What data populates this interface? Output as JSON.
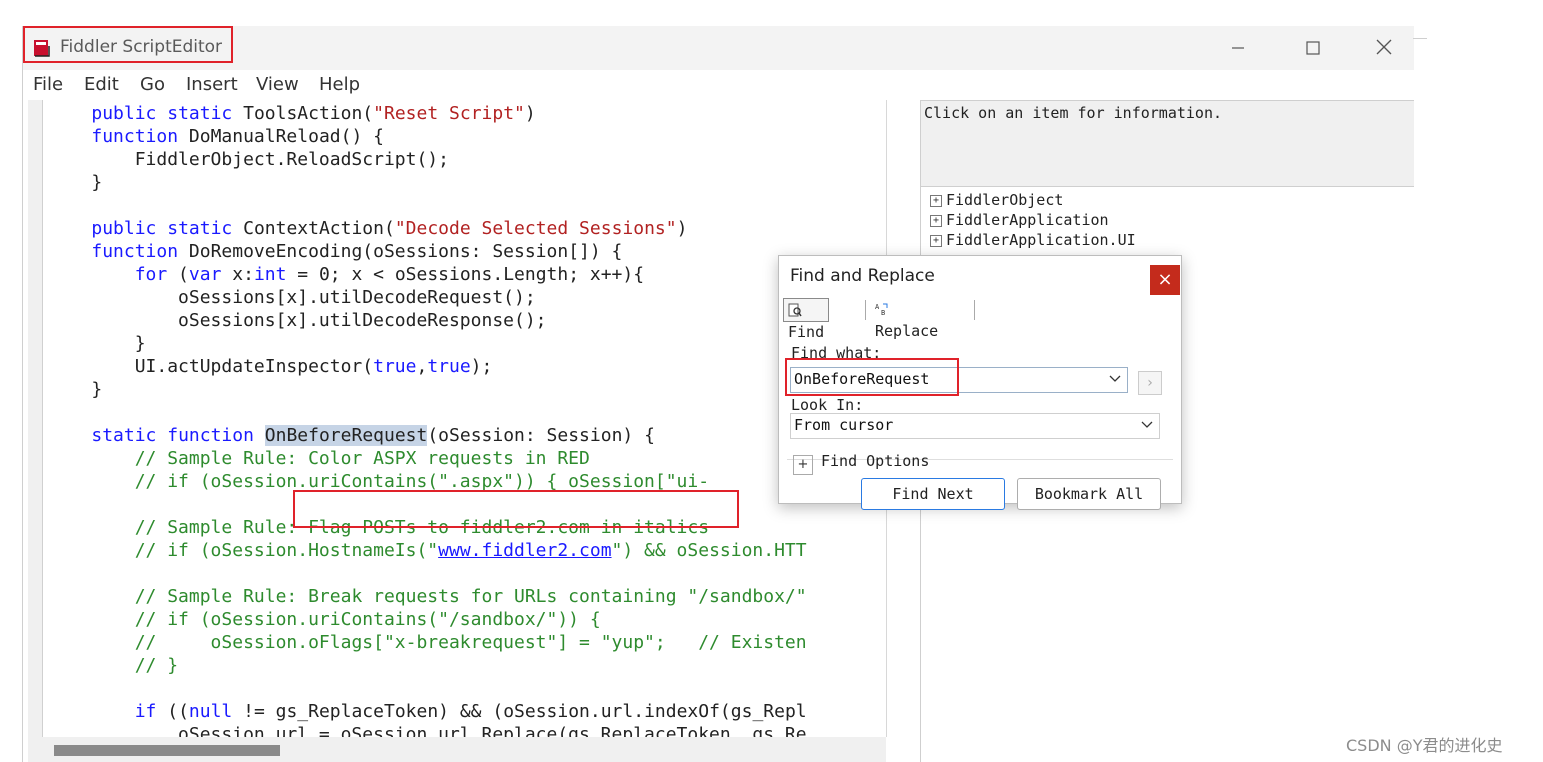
{
  "window": {
    "title": "Fiddler ScriptEditor",
    "controls": [
      "minimize",
      "maximize",
      "close"
    ]
  },
  "menu": [
    "File",
    "Edit",
    "Go",
    "Insert",
    "View",
    "Help"
  ],
  "info_panel": {
    "text": "Click on an item for information."
  },
  "tree": {
    "items": [
      "FiddlerObject",
      "FiddlerApplication",
      "FiddlerApplication.UI"
    ]
  },
  "dialog": {
    "title": "Find and Replace",
    "close": "×",
    "tabs": {
      "find": "Find",
      "replace": "Replace"
    },
    "find_what_label": "Find what:",
    "find_what_value": "OnBeforeRequest",
    "look_in_label": "Look In:",
    "look_in_value": "From cursor",
    "find_options_label": "Find Options",
    "find_options_toggle": "+",
    "find_next_label": "Find Next",
    "bookmark_all_label": "Bookmark All"
  },
  "watermark": "CSDN @Y君的进化史"
}
